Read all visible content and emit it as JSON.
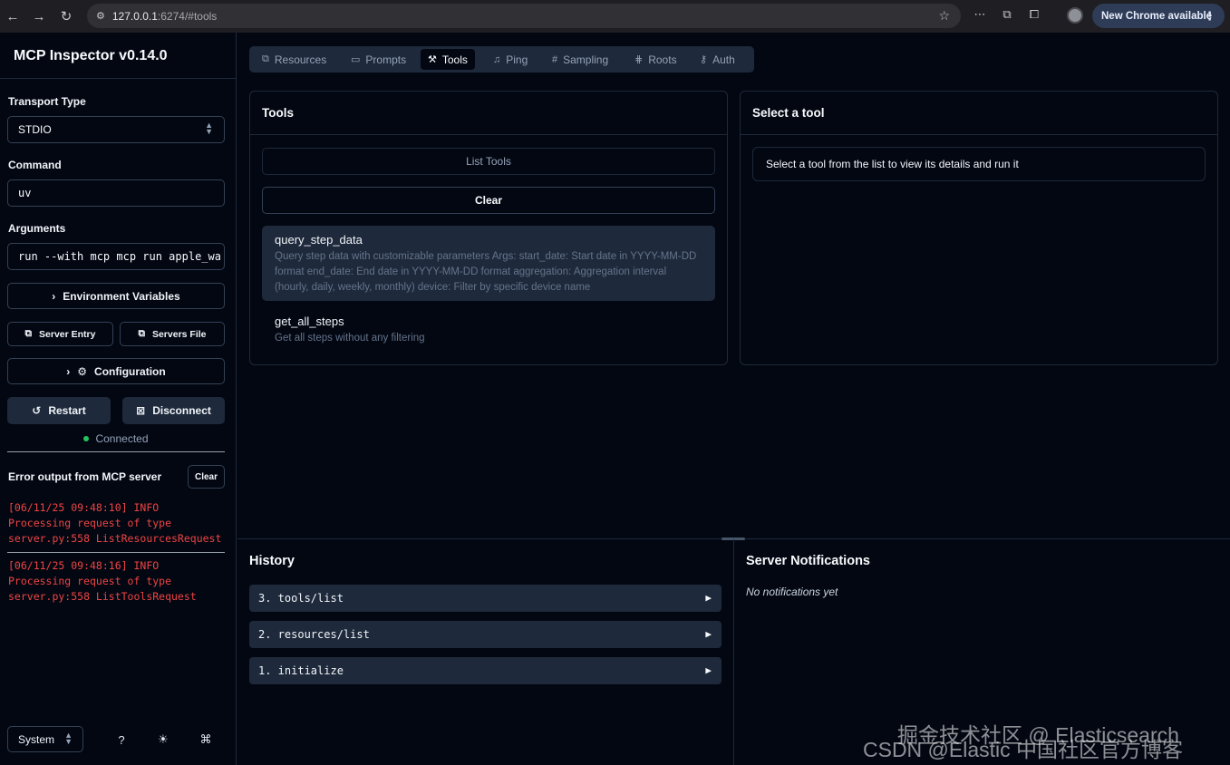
{
  "browser": {
    "url_host": "127.0.0.1",
    "url_path": ":6274/#tools",
    "new_chrome_label": "New Chrome available"
  },
  "sidebar": {
    "app_title": "MCP Inspector v0.14.0",
    "transport_label": "Transport Type",
    "transport_value": "STDIO",
    "command_label": "Command",
    "command_value": "uv",
    "arguments_label": "Arguments",
    "arguments_value": "run --with mcp mcp run apple_wa",
    "env_vars_label": "Environment Variables",
    "server_entry_label": "Server Entry",
    "servers_file_label": "Servers File",
    "configuration_label": "Configuration",
    "restart_label": "Restart",
    "disconnect_label": "Disconnect",
    "status_text": "Connected",
    "status_color": "#22c55e",
    "error_title": "Error output from MCP server",
    "error_clear_label": "Clear",
    "logs": [
      "[06/11/25 09:48:10] INFO\nProcessing request of type\nserver.py:558 ListResourcesRequest",
      "[06/11/25 09:48:16] INFO\nProcessing request of type\nserver.py:558 ListToolsRequest"
    ],
    "theme_value": "System"
  },
  "tabs": [
    {
      "label": "Resources",
      "icon": "resources-icon",
      "glyph": "⧉"
    },
    {
      "label": "Prompts",
      "icon": "message-square-icon",
      "glyph": "▭"
    },
    {
      "label": "Tools",
      "icon": "hammer-icon",
      "glyph": "⚒"
    },
    {
      "label": "Ping",
      "icon": "bell-icon",
      "glyph": "♫"
    },
    {
      "label": "Sampling",
      "icon": "hash-icon",
      "glyph": "#"
    },
    {
      "label": "Roots",
      "icon": "folder-tree-icon",
      "glyph": "⋕"
    },
    {
      "label": "Auth",
      "icon": "key-icon",
      "glyph": "⚷"
    }
  ],
  "tools_panel": {
    "title": "Tools",
    "list_tools_label": "List Tools",
    "clear_label": "Clear",
    "tools": [
      {
        "name": "query_step_data",
        "description": "Query step data with customizable parameters Args: start_date: Start date in YYYY-MM-DD format end_date: End date in YYYY-MM-DD format aggregation: Aggregation interval (hourly, daily, weekly, monthly) device: Filter by specific device name"
      },
      {
        "name": "get_all_steps",
        "description": "Get all steps without any filtering"
      }
    ]
  },
  "detail_panel": {
    "title": "Select a tool",
    "hint": "Select a tool from the list to view its details and run it"
  },
  "history": {
    "title": "History",
    "items": [
      "3. tools/list",
      "2. resources/list",
      "1. initialize"
    ]
  },
  "notifications": {
    "title": "Server Notifications",
    "empty_text": "No notifications yet"
  },
  "watermark": {
    "line1": "掘金技术社区 @ Elasticsearch",
    "line2": "CSDN @Elastic 中国社区官方博客"
  }
}
